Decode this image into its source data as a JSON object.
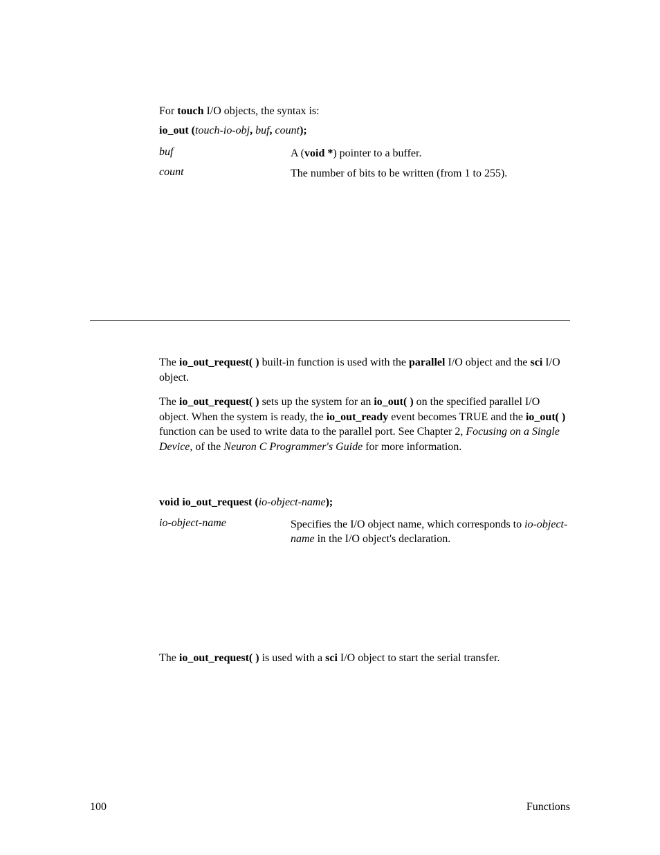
{
  "intro": {
    "pre": "For ",
    "bold": "touch",
    "post": " I/O objects, the syntax is:"
  },
  "syntax1": {
    "fn": "io_out (",
    "args": "touch-io-obj",
    "sep1": ", ",
    "arg2": "buf",
    "sep2": ", ",
    "arg3": "count",
    "close": ");"
  },
  "params1": {
    "buf_term": "buf",
    "buf_pre": "A (",
    "buf_bold": "void *",
    "buf_post": ") pointer to a buffer.",
    "count_term": "count",
    "count_def": "The number of bits to be written (from 1 to 255)."
  },
  "desc1": {
    "p1_pre": "The ",
    "p1_b1": "io_out_request( )",
    "p1_mid1": " built-in function is used with the ",
    "p1_b2": "parallel",
    "p1_mid2": " I/O object and the ",
    "p1_b3": "sci",
    "p1_post": " I/O object."
  },
  "desc2": {
    "pre": "The ",
    "b1": "io_out_request( )",
    "t1": " sets up the system for an ",
    "b2": "io_out( )",
    "t2": " on the specified parallel I/O object.  When the system is ready, the ",
    "b3": "io_out_ready",
    "t3": " event becomes TRUE and the ",
    "b4": "io_out( )",
    "t4": " function can be used to write data to the parallel port.  See Chapter 2, ",
    "i1": "Focusing on a Single Device,",
    "t5": " of the ",
    "i2": "Neuron C Programmer's Guide",
    "t6": " for more information."
  },
  "syntax2": {
    "b1": "void io_out_request (",
    "i1": "io-object-name",
    "b2": ");"
  },
  "params2": {
    "term": "io-object-name",
    "def_t1": "Specifies the I/O object name, which corresponds to ",
    "def_i1": "io-object-name",
    "def_t2": " in the I/O object's declaration."
  },
  "desc3": {
    "pre": "The ",
    "b1": "io_out_request( )",
    "t1": "  is used with a ",
    "b2": "sci",
    "t2": " I/O object to start the serial transfer."
  },
  "footer": {
    "page": "100",
    "section": "Functions"
  }
}
